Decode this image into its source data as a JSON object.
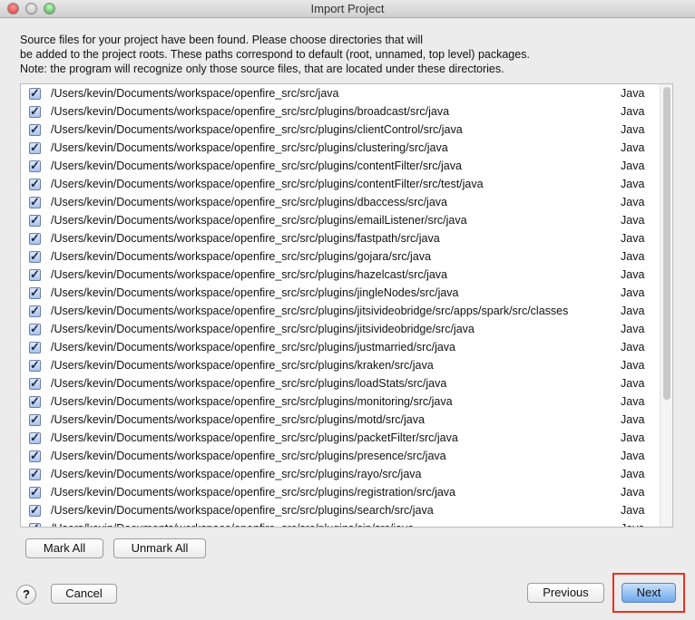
{
  "window": {
    "title": "Import Project"
  },
  "description": [
    "Source files for your project have been found. Please choose directories that will",
    "be added to the project roots. These paths correspond to default (root, unnamed, top level) packages.",
    "Note: the program will recognize only those source files, that are located under these directories."
  ],
  "rows": [
    {
      "path": "/Users/kevin/Documents/workspace/openfire_src/src/java",
      "lang": "Java",
      "checked": true
    },
    {
      "path": "/Users/kevin/Documents/workspace/openfire_src/src/plugins/broadcast/src/java",
      "lang": "Java",
      "checked": true
    },
    {
      "path": "/Users/kevin/Documents/workspace/openfire_src/src/plugins/clientControl/src/java",
      "lang": "Java",
      "checked": true
    },
    {
      "path": "/Users/kevin/Documents/workspace/openfire_src/src/plugins/clustering/src/java",
      "lang": "Java",
      "checked": true
    },
    {
      "path": "/Users/kevin/Documents/workspace/openfire_src/src/plugins/contentFilter/src/java",
      "lang": "Java",
      "checked": true
    },
    {
      "path": "/Users/kevin/Documents/workspace/openfire_src/src/plugins/contentFilter/src/test/java",
      "lang": "Java",
      "checked": true
    },
    {
      "path": "/Users/kevin/Documents/workspace/openfire_src/src/plugins/dbaccess/src/java",
      "lang": "Java",
      "checked": true
    },
    {
      "path": "/Users/kevin/Documents/workspace/openfire_src/src/plugins/emailListener/src/java",
      "lang": "Java",
      "checked": true
    },
    {
      "path": "/Users/kevin/Documents/workspace/openfire_src/src/plugins/fastpath/src/java",
      "lang": "Java",
      "checked": true
    },
    {
      "path": "/Users/kevin/Documents/workspace/openfire_src/src/plugins/gojara/src/java",
      "lang": "Java",
      "checked": true
    },
    {
      "path": "/Users/kevin/Documents/workspace/openfire_src/src/plugins/hazelcast/src/java",
      "lang": "Java",
      "checked": true
    },
    {
      "path": "/Users/kevin/Documents/workspace/openfire_src/src/plugins/jingleNodes/src/java",
      "lang": "Java",
      "checked": true
    },
    {
      "path": "/Users/kevin/Documents/workspace/openfire_src/src/plugins/jitsivideobridge/src/apps/spark/src/classes",
      "lang": "Java",
      "checked": true
    },
    {
      "path": "/Users/kevin/Documents/workspace/openfire_src/src/plugins/jitsivideobridge/src/java",
      "lang": "Java",
      "checked": true
    },
    {
      "path": "/Users/kevin/Documents/workspace/openfire_src/src/plugins/justmarried/src/java",
      "lang": "Java",
      "checked": true
    },
    {
      "path": "/Users/kevin/Documents/workspace/openfire_src/src/plugins/kraken/src/java",
      "lang": "Java",
      "checked": true
    },
    {
      "path": "/Users/kevin/Documents/workspace/openfire_src/src/plugins/loadStats/src/java",
      "lang": "Java",
      "checked": true
    },
    {
      "path": "/Users/kevin/Documents/workspace/openfire_src/src/plugins/monitoring/src/java",
      "lang": "Java",
      "checked": true
    },
    {
      "path": "/Users/kevin/Documents/workspace/openfire_src/src/plugins/motd/src/java",
      "lang": "Java",
      "checked": true
    },
    {
      "path": "/Users/kevin/Documents/workspace/openfire_src/src/plugins/packetFilter/src/java",
      "lang": "Java",
      "checked": true
    },
    {
      "path": "/Users/kevin/Documents/workspace/openfire_src/src/plugins/presence/src/java",
      "lang": "Java",
      "checked": true
    },
    {
      "path": "/Users/kevin/Documents/workspace/openfire_src/src/plugins/rayo/src/java",
      "lang": "Java",
      "checked": true
    },
    {
      "path": "/Users/kevin/Documents/workspace/openfire_src/src/plugins/registration/src/java",
      "lang": "Java",
      "checked": true
    },
    {
      "path": "/Users/kevin/Documents/workspace/openfire_src/src/plugins/search/src/java",
      "lang": "Java",
      "checked": true
    },
    {
      "path": "/Users/kevin/Documents/workspace/openfire_src/src/plugins/sip/src/java",
      "lang": "Java",
      "checked": true
    }
  ],
  "buttons": {
    "mark_all": "Mark All",
    "unmark_all": "Unmark All",
    "help": "?",
    "cancel": "Cancel",
    "previous": "Previous",
    "next": "Next"
  }
}
